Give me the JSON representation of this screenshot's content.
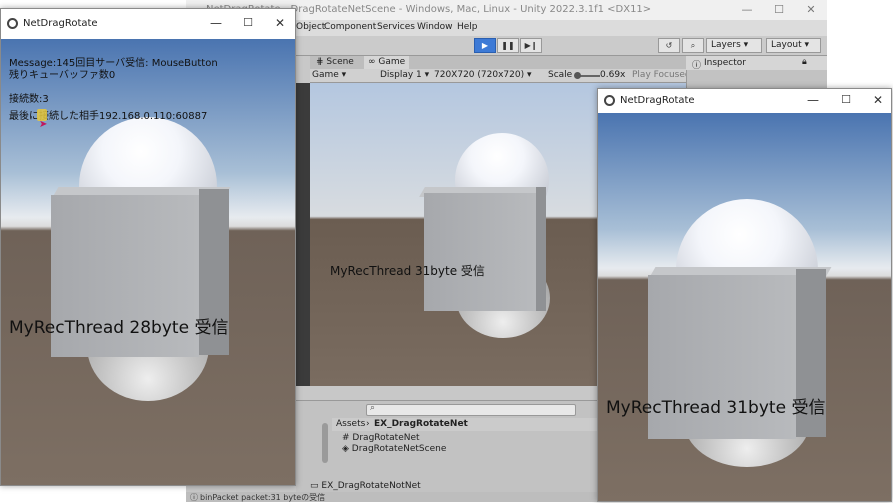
{
  "unity": {
    "title": "NetDragRotate - DragRotateNetScene - Windows, Mac, Linux - Unity 2022.3.1f1 <DX11>",
    "menu": [
      "Object",
      "Component",
      "Services",
      "Window",
      "Help"
    ],
    "layers_label": "Layers",
    "layout_label": "Layout",
    "tabs": {
      "scene": "Scene",
      "game": "Game"
    },
    "gamebar": {
      "mode": "Game",
      "display": "Display 1",
      "resolution": "720X720 (720x720)",
      "scale_label": "Scale",
      "scale_value": "0.69x",
      "play_focused": "Play Focused"
    },
    "inspector_label": "Inspector",
    "game_message": "MyRecThread 31byte 受信",
    "project": {
      "breadcrumb_root": "Assets",
      "breadcrumb_folder": "EX_DragRotateNet",
      "items": [
        "DragRotateNet",
        "DragRotateNetScene"
      ],
      "left_item": "EX_DragRotateNotNet"
    },
    "status": "binPacket packet:31 byteの受信"
  },
  "left_window": {
    "title": "NetDragRotate",
    "message_line1": "Message:145回目サーバ受信: MouseButton",
    "message_line2": "残りキューバッファ数0",
    "connections": "接続数:3",
    "last_connected": "最後に接続した相手192.168.0.110:60887",
    "big_text": "MyRecThread 28byte 受信"
  },
  "right_window": {
    "title": "NetDragRotate",
    "big_text": "MyRecThread 31byte 受信"
  }
}
